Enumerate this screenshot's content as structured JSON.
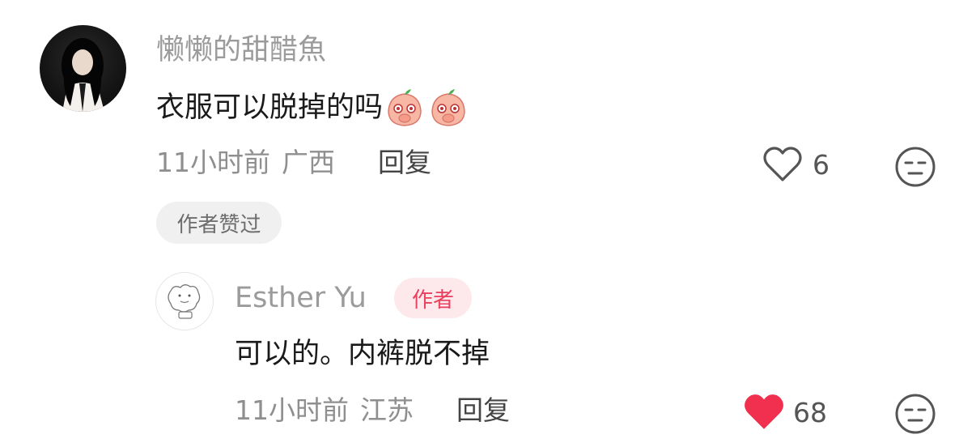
{
  "comment": {
    "username": "懒懒的甜醋魚",
    "text": "衣服可以脱掉的吗",
    "emoji_icons": [
      "peach-cover-mouth-icon",
      "peach-cover-mouth-icon"
    ],
    "time": "11小时前",
    "location": "广西",
    "reply_label": "回复",
    "likes": "6",
    "liked_by_author_badge": "作者赞过",
    "like_state": "not-liked"
  },
  "reply": {
    "username": "Esther Yu",
    "author_badge": "作者",
    "text": "可以的。内裤脱不掉",
    "time": "11小时前",
    "location": "江苏",
    "reply_label": "回复",
    "likes": "68",
    "like_state": "liked"
  },
  "colors": {
    "like_active": "#f0304e",
    "author_badge_text": "#ea3f5d",
    "author_badge_bg": "#fde8ec",
    "username": "#9b9b9b"
  }
}
